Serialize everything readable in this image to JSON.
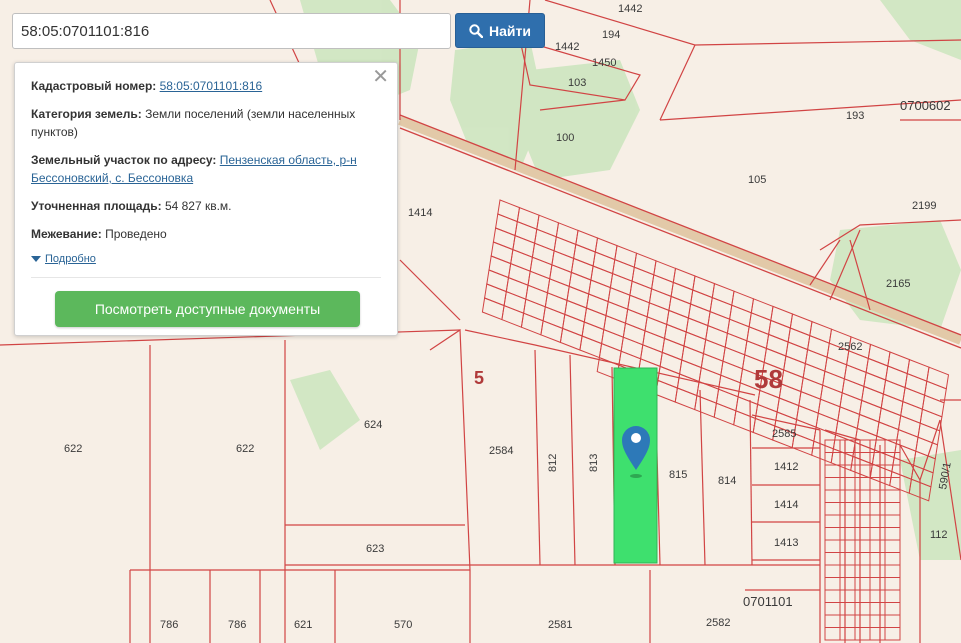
{
  "search": {
    "value": "58:05:0701101:816",
    "button_label": "Найти"
  },
  "info_panel": {
    "cadastral_label": "Кадастровый номер:",
    "cadastral_value": "58:05:0701101:816",
    "category_label": "Категория земель:",
    "category_value": "Земли поселений (земли населенных пунктов)",
    "address_label": "Земельный участок по адресу:",
    "address_value": "Пензенская область, р-н Бессоновский, с. Бессоновка",
    "area_label": "Уточненная площадь:",
    "area_value": "54 827 кв.м.",
    "survey_label": "Межевание:",
    "survey_value": "Проведено",
    "more_label": "Подробно",
    "close_symbol": "✕",
    "docs_button": "Посмотреть доступные документы"
  },
  "map": {
    "region_number": "58",
    "small_number": "5",
    "quarter_1": "0700602",
    "quarter_2": "0701101",
    "parcels": [
      "1442",
      "194",
      "1442",
      "1450",
      "103",
      "100",
      "193",
      "105",
      "2199",
      "1414",
      "2165",
      "2562",
      "624",
      "622",
      "622",
      "2584",
      "812",
      "813",
      "815",
      "814",
      "2585",
      "1412",
      "1414",
      "1413",
      "590/1",
      "112",
      "623",
      "786",
      "786",
      "621",
      "570",
      "2581",
      "2582"
    ]
  },
  "colors": {
    "boundary": "#d14444",
    "highlight": "#3ee06e",
    "marker": "#2d79b8",
    "button_primary": "#2f6fad",
    "button_success": "#5cb85c"
  },
  "icons": [
    "search-icon",
    "close-icon",
    "chevron-down-icon",
    "map-marker-icon"
  ]
}
